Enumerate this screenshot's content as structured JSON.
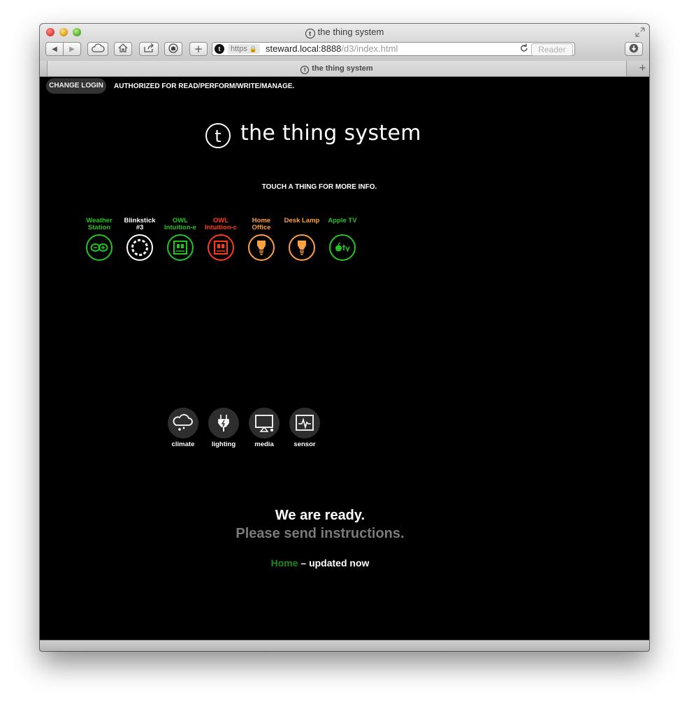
{
  "window": {
    "title": "the thing system",
    "title_glyph": "t"
  },
  "toolbar": {
    "back_label": "◀",
    "forward_label": "▶",
    "cloud_icon": "cloud-icon",
    "home_icon": "home-icon",
    "share_icon": "share-icon",
    "shield_icon": "shield-icon",
    "add_label": "+",
    "download_icon": "download-icon"
  },
  "address": {
    "favicon": "t",
    "scheme": "https",
    "host": "steward.local:8888",
    "path": "/d3/index.html",
    "reader_label": "Reader"
  },
  "tab": {
    "label": "the thing system",
    "glyph": "t",
    "new_tab_label": "+"
  },
  "header": {
    "change_login_label": "CHANGE LOGIN",
    "authorization_text": "AUTHORIZED FOR READ/PERFORM/WRITE/MANAGE."
  },
  "brand": {
    "logo_letter": "t",
    "name": "the thing system"
  },
  "hint": "TOUCH A THING FOR MORE INFO.",
  "things": [
    {
      "label_line1": "Weather",
      "label_line2": "Station",
      "color": "#22c422",
      "icon": "arduino-icon"
    },
    {
      "label_line1": "Blinkstick",
      "label_line2": "#3",
      "color": "#ffffff",
      "icon": "ring-lights-icon"
    },
    {
      "label_line1": "OWL",
      "label_line2": "Intuition-e",
      "color": "#22c422",
      "icon": "meter-icon"
    },
    {
      "label_line1": "OWL",
      "label_line2": "Intuition-c",
      "color": "#ff3a1a",
      "icon": "meter-icon"
    },
    {
      "label_line1": "Home",
      "label_line2": "Office",
      "color": "#ffa040",
      "icon": "bulb-icon"
    },
    {
      "label_line1": "Desk Lamp",
      "label_line2": "",
      "color": "#ffa040",
      "icon": "bulb-icon"
    },
    {
      "label_line1": "Apple TV",
      "label_line2": "",
      "color": "#22c422",
      "icon": "apple-tv-icon"
    }
  ],
  "categories": [
    {
      "label": "climate",
      "icon": "climate-icon"
    },
    {
      "label": "lighting",
      "icon": "plug-icon"
    },
    {
      "label": "media",
      "icon": "monitor-icon"
    },
    {
      "label": "sensor",
      "icon": "pulse-icon"
    }
  ],
  "status": {
    "line1": "We are ready.",
    "line2": "Please send instructions.",
    "place_link": "Home",
    "separator": " – ",
    "updated": "updated now"
  }
}
